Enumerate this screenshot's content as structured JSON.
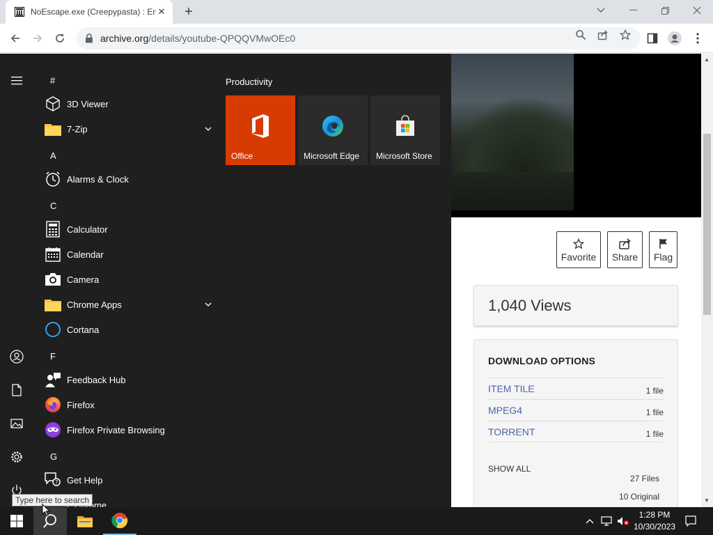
{
  "browser": {
    "tab_title": "NoEscape.exe (Creepypasta) : En",
    "tab_close": "✕",
    "new_tab": "+",
    "url_host": "archive.org",
    "url_path": "/details/youtube-QPQQVMwOEc0"
  },
  "page": {
    "actions": [
      {
        "label": "Favorite",
        "icon": "star-icon"
      },
      {
        "label": "Share",
        "icon": "share-icon"
      },
      {
        "label": "Flag",
        "icon": "flag-icon"
      }
    ],
    "views": "1,040 Views",
    "download": {
      "heading": "DOWNLOAD OPTIONS",
      "rows": [
        {
          "name": "ITEM TILE",
          "count": "1 file"
        },
        {
          "name": "MPEG4",
          "count": "1 file"
        },
        {
          "name": "TORRENT",
          "count": "1 file"
        }
      ],
      "show_all": "SHOW ALL",
      "total_files": "27 Files",
      "original": "10 Original"
    },
    "link_color": "#4b64a8"
  },
  "start_menu": {
    "headers": {
      "hash": "#",
      "a": "A",
      "c": "C",
      "f": "F",
      "g": "G"
    },
    "apps": {
      "viewer3d": "3D Viewer",
      "zip": "7-Zip",
      "alarms": "Alarms & Clock",
      "calculator": "Calculator",
      "calendar": "Calendar",
      "camera": "Camera",
      "chrome_apps": "Chrome Apps",
      "cortana": "Cortana",
      "feedback": "Feedback Hub",
      "firefox": "Firefox",
      "firefox_private": "Firefox Private Browsing",
      "get_help": "Get Help",
      "chrome_partial": "e Chrome"
    },
    "group_title": "Productivity",
    "tiles": [
      {
        "label": "Office",
        "color": "#d83b01"
      },
      {
        "label": "Microsoft Edge",
        "color": "#2b2b2b"
      },
      {
        "label": "Microsoft Store",
        "color": "#2b2b2b"
      }
    ]
  },
  "tooltip": "Type here to search",
  "taskbar": {
    "time": "1:28 PM",
    "date": "10/30/2023"
  }
}
